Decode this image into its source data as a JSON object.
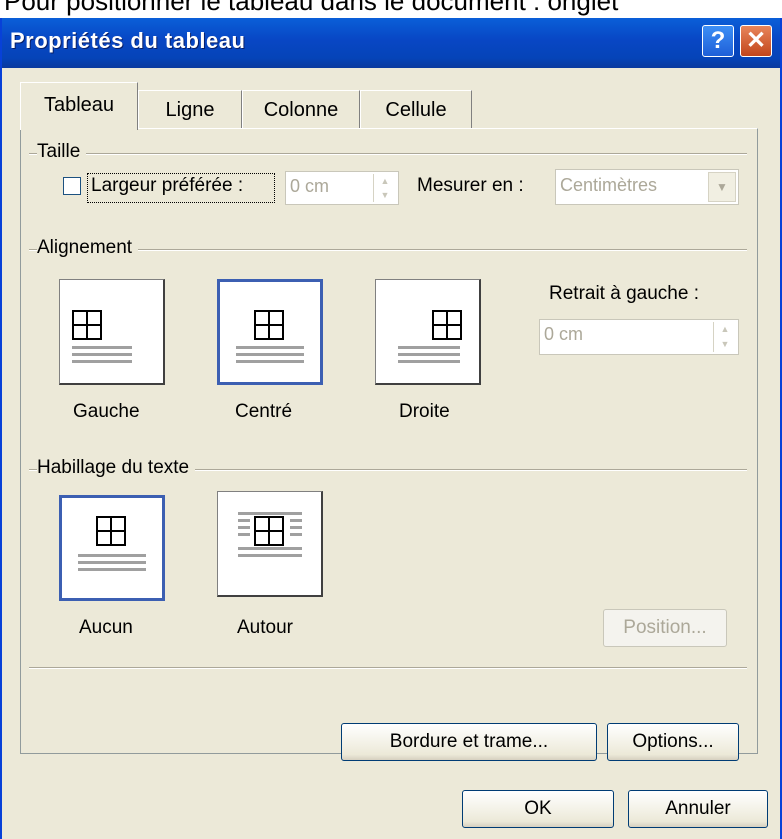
{
  "caption_fragment": "Pour positionner le tableau dans le document : onglet",
  "window": {
    "title": "Propriétés du tableau"
  },
  "tabs": [
    {
      "label": "Tableau",
      "active": true
    },
    {
      "label": "Ligne",
      "active": false
    },
    {
      "label": "Colonne",
      "active": false
    },
    {
      "label": "Cellule",
      "active": false
    }
  ],
  "taille": {
    "group_label": "Taille",
    "preferred_width_label": "Largeur préférée :",
    "preferred_width_checked": false,
    "preferred_width_value": "0 cm",
    "measure_label": "Mesurer en :",
    "measure_value": "Centimètres"
  },
  "alignement": {
    "group_label": "Alignement",
    "options": [
      {
        "label": "Gauche",
        "selected": false
      },
      {
        "label": "Centré",
        "selected": true
      },
      {
        "label": "Droite",
        "selected": false
      }
    ],
    "indent_label": "Retrait à gauche :",
    "indent_value": "0 cm"
  },
  "habillage": {
    "group_label": "Habillage du texte",
    "options": [
      {
        "label": "Aucun",
        "selected": true
      },
      {
        "label": "Autour",
        "selected": false
      }
    ],
    "position_button": "Position..."
  },
  "buttons": {
    "borders": "Bordure et trame...",
    "options": "Options...",
    "ok": "OK",
    "cancel": "Annuler"
  },
  "colors": {
    "titlebar": "#0846c4",
    "dialog_bg": "#ece9d8",
    "selected_border": "#3c5fb2"
  },
  "icons": [
    "help-icon",
    "close-icon",
    "table-grid-icon"
  ]
}
